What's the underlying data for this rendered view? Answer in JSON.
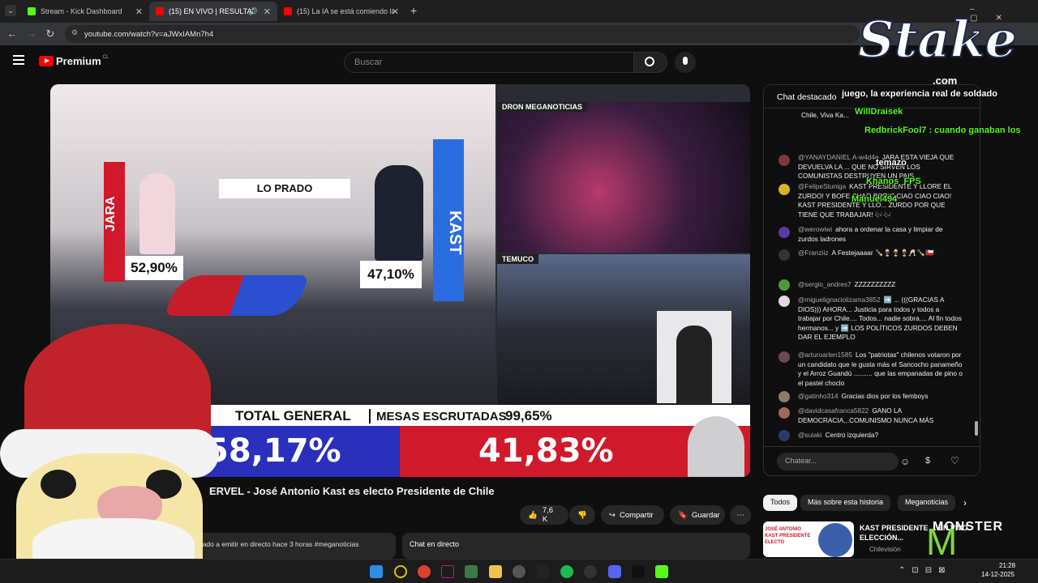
{
  "browser": {
    "tabs": [
      {
        "title": "Stream - Kick Dashboard",
        "active": false
      },
      {
        "title": "(15) EN VIVO | RESULTADOS",
        "active": true
      },
      {
        "title": "(15) La IA se está comiendo la",
        "active": false
      }
    ],
    "url": "youtube.com/watch?v=aJWxIAMn7h4"
  },
  "youtube": {
    "logo": "Premium",
    "region": "CL",
    "search_placeholder": "Buscar"
  },
  "video": {
    "candidate_left": "JARA",
    "candidate_right": "KAST",
    "location": "LO PRADO",
    "pct_left_small": "52,90%",
    "pct_right_small": "47,10%",
    "feed1_label": "DRON MEGANOTICIAS",
    "feed2_label": "TEMUCO",
    "total_label": "TOTAL GENERAL",
    "mesas_label": "MESAS ESCRUTADAS",
    "mesas_value": "99,65%",
    "total_left": "58,17%",
    "total_right": "41,83%"
  },
  "video_title": "ERVEL - José Antonio Kast es electo Presidente de Chile",
  "actions": {
    "likes": "7,6 K",
    "share": "Compartir",
    "save": "Guardar"
  },
  "description_snippet": "pezado a emitir en directo hace 3 horas  #meganoticias",
  "chat_panel_label": "Chat en directo",
  "chat": {
    "header": "Chat destacado",
    "input_placeholder": "Chatear...",
    "messages": [
      {
        "author": "",
        "text": "Chile, Viva Ka..."
      },
      {
        "author": "@YANAYDANIEL A-w4d4e",
        "text": "JARA ESTA VIEJA QUE DEVUELVA LA ... QUE NO SIRVEN LOS COMUNISTAS DESTRUYEN UN PAIS"
      },
      {
        "author": "@FelipeStuniga",
        "text": "KAST PRESIDENTE Y LLORE EL ZURDO! Y BOFE CHAO BORIC CIAO CIAO CIAO! KAST PRESIDENTE Y LLO... ZURDO POR QUE TIENE QUE TRABAJAR! 🎶🎶"
      },
      {
        "author": "@werowiwi",
        "text": "ahora a ordenar la casa y limpiar de zurdos ladrones"
      },
      {
        "author": "@Franziiz",
        "text": "A Festejaaaar 🍾🍷🍷🍷🥂🍾🇨🇱"
      },
      {
        "author": "@sergio_andres7",
        "text": "ZZZZZZZZZZ"
      },
      {
        "author": "@miguelignaciolizama3852",
        "text": "➡️ ... (((GRACIAS A DIOS))) AHORA... Justicia para todos y todos a trabajar por Chile.... Todos... nadie sobra.... Al fin todos hermanos... y ➡️ LOS POLÍTICOS ZURDOS DEBEN DAR EL EJEMPLO"
      },
      {
        "author": "@arturoarlen1585",
        "text": "Los \"patriotas\" chilenos votaron por un candidato que le gusta más el Sancocho panameño y el Arroz Guandú .......... que las empanadas de pino o el pastel choclo"
      },
      {
        "author": "@gatinho314",
        "text": "Gracias dios por los femboys"
      },
      {
        "author": "@davidcasafranca5822",
        "text": "GANO LA DEMOCRACIA...COMUNISMO NUNCA MÁS"
      },
      {
        "author": "@suiaki",
        "text": "Centro izquierda?"
      }
    ]
  },
  "chips": [
    "Todos",
    "Más sobre esta historia",
    "Meganoticias"
  ],
  "related": {
    "title": "KAST PRESIDENTE ... EN VIVO ELECCIÓN...",
    "channel": "Chilevisión",
    "thumb_label": "JOSÉ ANTONIO KAST PRESIDENTE ELECTO"
  },
  "overlay": {
    "brand": "Stake",
    "brand_sub": ".com",
    "line1": "juego, la experiencia real de soldado",
    "users": [
      "WillDraisek",
      "RedbrickFool7 : cuando ganaban los",
      "temazo",
      "Khanos_FPS",
      "Manuel494"
    ],
    "sponsor": "MONSTER"
  },
  "taskbar": {
    "time": "21:28",
    "date": "14-12-2025"
  }
}
